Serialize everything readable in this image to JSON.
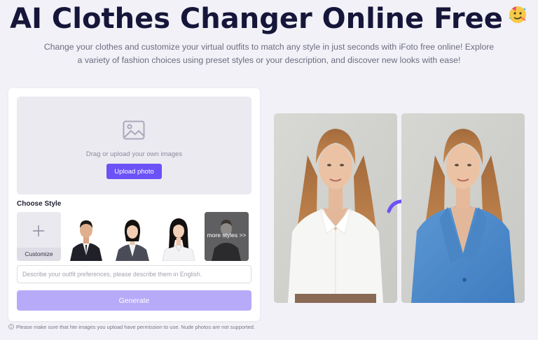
{
  "header": {
    "title": "AI Clothes Changer Online Free",
    "subtitle": "Change your clothes and customize your virtual outfits to match any style in just seconds with iFoto free online! Explore a variety of fashion choices using preset styles or your description, and discover new looks with ease!"
  },
  "upload": {
    "hint": "Drag or upload your own images",
    "button_label": "Upload photo",
    "icon": "image-icon"
  },
  "styles": {
    "heading": "Choose Style",
    "customize_label": "Customize",
    "more_label": "more styles >>",
    "presets": [
      "man-in-suit",
      "woman-in-blazer",
      "woman-in-white-shirt"
    ]
  },
  "prompt": {
    "placeholder": "Describe your outfit preferences, please describe them in English."
  },
  "generate": {
    "label": "Generate"
  },
  "notice": "Please make sure that hte images you upload have permission to use. Nude photos are not supported.",
  "colors": {
    "accent": "#6b52f6",
    "generate_disabled": "#b7aaf9",
    "page_bg": "#f1f1f7",
    "title": "#16163a"
  }
}
